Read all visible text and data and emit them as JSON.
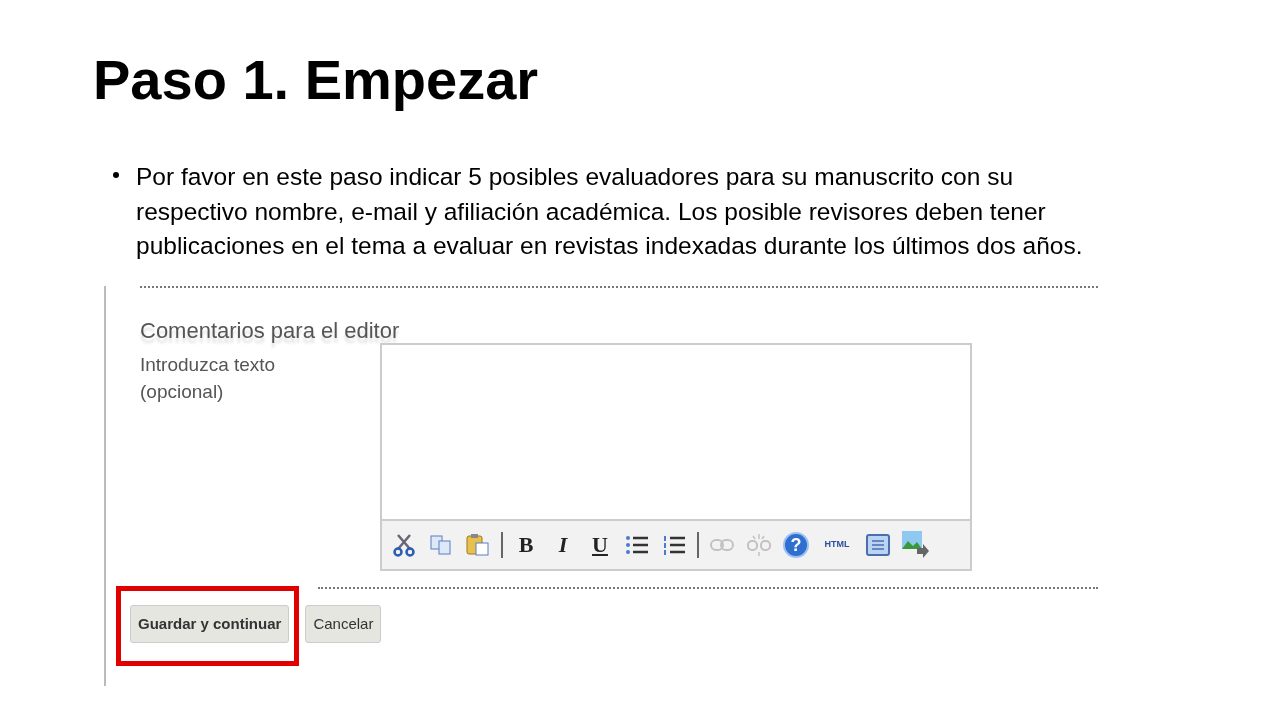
{
  "slide": {
    "title": "Paso 1. Empezar",
    "bullets": [
      "Por favor en este paso indicar 5 posibles evaluadores para su manuscrito con su respectivo nombre, e-mail y afiliación académica. Los posible revisores deben tener publicaciones en el tema a evaluar en revistas indexadas durante los últimos dos años."
    ]
  },
  "form": {
    "heading": "Comentarios para el editor",
    "field_label": "Introduzca texto (opcional)",
    "toolbar": [
      {
        "kind": "cut",
        "disabled": false
      },
      {
        "kind": "copy",
        "disabled": false
      },
      {
        "kind": "paste",
        "disabled": false
      },
      {
        "kind": "separator"
      },
      {
        "kind": "bold",
        "label": "B",
        "disabled": false
      },
      {
        "kind": "italic",
        "label": "I",
        "disabled": false
      },
      {
        "kind": "underline",
        "label": "U",
        "disabled": false
      },
      {
        "kind": "bullets",
        "disabled": false
      },
      {
        "kind": "numbers",
        "disabled": false
      },
      {
        "kind": "separator"
      },
      {
        "kind": "link",
        "disabled": true
      },
      {
        "kind": "unlink",
        "disabled": true
      },
      {
        "kind": "help",
        "label": "?",
        "disabled": false
      },
      {
        "kind": "html",
        "label": "HTML",
        "disabled": false
      },
      {
        "kind": "fullscreen",
        "disabled": false
      },
      {
        "kind": "image",
        "disabled": false
      }
    ],
    "buttons": [
      {
        "label": "Guardar y continuar",
        "highlighted": true
      },
      {
        "label": "Cancelar",
        "highlighted": false
      }
    ]
  }
}
